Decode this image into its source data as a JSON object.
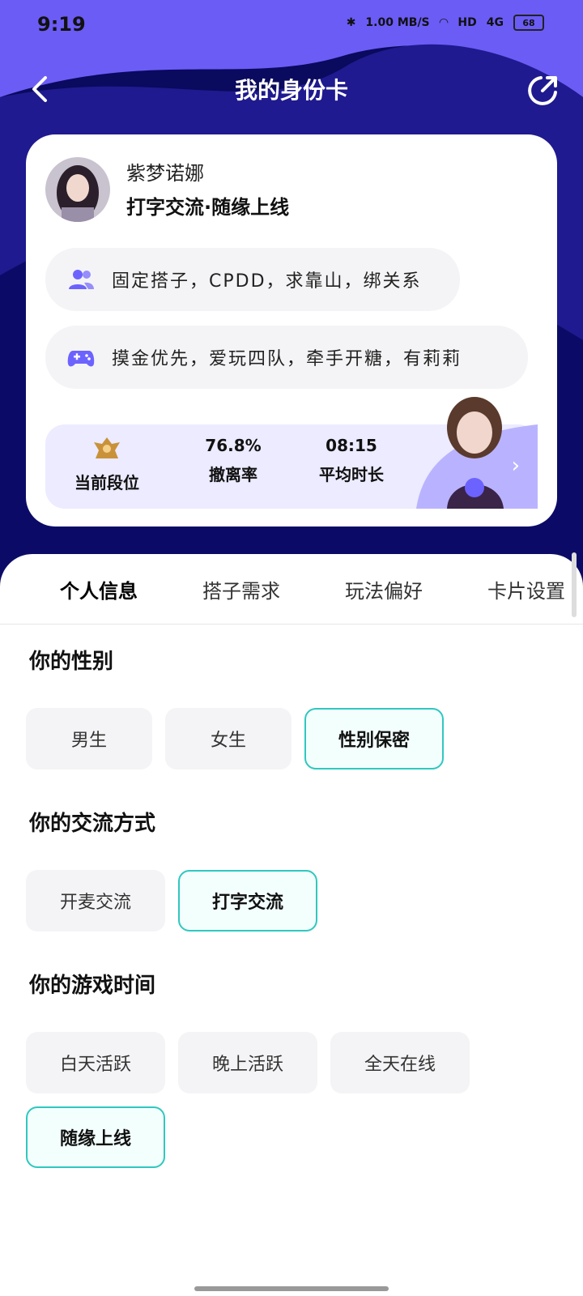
{
  "status_bar": {
    "time": "9:19",
    "net_speed": "1.00 MB/S",
    "hd": "HD",
    "signal": "4G",
    "battery": "68"
  },
  "topbar": {
    "title": "我的身份卡",
    "back_icon": "back-arrow-icon",
    "share_icon": "share-icon"
  },
  "profile": {
    "name": "紫梦诺娜",
    "subtitle": "打字交流·随缘上线",
    "tags": [
      {
        "icon": "users-icon",
        "text": "固定搭子，CPDD，求靠山，绑关系"
      },
      {
        "icon": "gamepad-icon",
        "text": "摸金优先，爱玩四队，牵手开糖，有莉莉"
      }
    ],
    "stats": [
      {
        "value": "",
        "label": "当前段位"
      },
      {
        "value": "76.8%",
        "label": "撤离率"
      },
      {
        "value": "08:15",
        "label": "平均时长"
      }
    ]
  },
  "tabs": [
    "个人信息",
    "搭子需求",
    "玩法偏好",
    "卡片设置"
  ],
  "sections": {
    "gender": {
      "title": "你的性别",
      "options": [
        "男生",
        "女生",
        "性别保密"
      ],
      "selected": "性别保密"
    },
    "comm": {
      "title": "你的交流方式",
      "options": [
        "开麦交流",
        "打字交流"
      ],
      "selected": "打字交流"
    },
    "time": {
      "title": "你的游戏时间",
      "options": [
        "白天活跃",
        "晚上活跃",
        "全天在线",
        "随缘上线"
      ],
      "selected": "随缘上线"
    }
  },
  "colors": {
    "accent": "#6c63ff",
    "select_border": "#2fc8bf",
    "header_dark": "#0a0a5e"
  }
}
